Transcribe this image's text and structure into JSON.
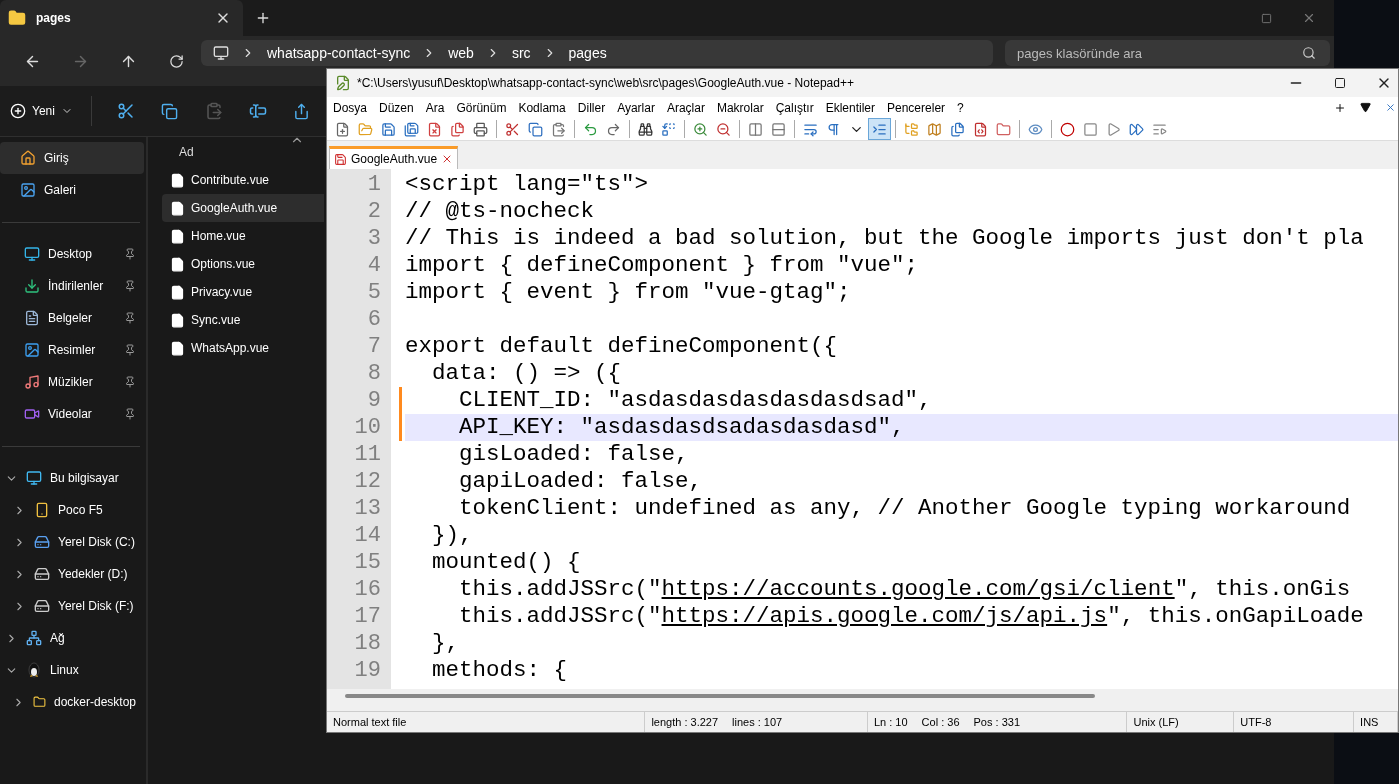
{
  "explorer": {
    "tab": {
      "title": "pages",
      "selected": true
    },
    "nav": {
      "forward_disabled": true,
      "crumbs": [
        "whatsapp-contact-sync",
        "web",
        "src",
        "pages"
      ]
    },
    "search": {
      "placeholder": "pages klasöründe ara"
    },
    "toolbar": {
      "new_label": "Yeni",
      "paste_disabled": true
    },
    "sidebar": {
      "quick": [
        {
          "label": "Giriş",
          "kind": "home",
          "selected": true
        },
        {
          "label": "Galeri",
          "kind": "gallery",
          "selected": false
        }
      ],
      "pinned": [
        {
          "label": "Desktop",
          "kind": "desktop",
          "selected": false,
          "pinned": true
        },
        {
          "label": "İndirilenler",
          "kind": "downloads",
          "selected": false,
          "pinned": true
        },
        {
          "label": "Belgeler",
          "kind": "documents",
          "selected": false,
          "pinned": true
        },
        {
          "label": "Resimler",
          "kind": "pictures",
          "selected": false,
          "pinned": true
        },
        {
          "label": "Müzikler",
          "kind": "music",
          "selected": false,
          "pinned": true
        },
        {
          "label": "Videolar",
          "kind": "videos",
          "selected": false,
          "pinned": true
        }
      ],
      "tree": [
        {
          "label": "Bu bilgisayar",
          "kind": "pc",
          "selected": false,
          "expanded": true,
          "children": [
            {
              "label": "Poco F5",
              "kind": "phone",
              "selected": false,
              "expanded": false
            },
            {
              "label": "Yerel Disk (C:)",
              "kind": "systemdisk",
              "selected": false,
              "expanded": false
            },
            {
              "label": "Yedekler (D:)",
              "kind": "disk",
              "selected": false,
              "expanded": false
            },
            {
              "label": "Yerel Disk (F:)",
              "kind": "disk",
              "selected": false,
              "expanded": false
            }
          ]
        },
        {
          "label": "Ağ",
          "kind": "network",
          "selected": false,
          "expanded": false
        },
        {
          "label": "Linux",
          "kind": "linux",
          "selected": false,
          "expanded": true,
          "children": [
            {
              "label": "docker-desktop",
              "kind": "folder",
              "selected": false,
              "expanded": false
            }
          ]
        }
      ]
    },
    "files": {
      "header": "Ad",
      "items": [
        {
          "name": "Contribute.vue",
          "selected": false
        },
        {
          "name": "GoogleAuth.vue",
          "selected": true
        },
        {
          "name": "Home.vue",
          "selected": false
        },
        {
          "name": "Options.vue",
          "selected": false
        },
        {
          "name": "Privacy.vue",
          "selected": false
        },
        {
          "name": "Sync.vue",
          "selected": false
        },
        {
          "name": "WhatsApp.vue",
          "selected": false
        }
      ]
    }
  },
  "notepad": {
    "title": "*C:\\Users\\yusuf\\Desktop\\whatsapp-contact-sync\\web\\src\\pages\\GoogleAuth.vue - Notepad++",
    "menu": [
      "Dosya",
      "Düzen",
      "Ara",
      "Görünüm",
      "Kodlama",
      "Diller",
      "Ayarlar",
      "Araçlar",
      "Makrolar",
      "Çalıştır",
      "Eklentiler",
      "Pencereler",
      "?"
    ],
    "tabs": [
      {
        "label": "GoogleAuth.vue",
        "selected": true,
        "modified": true
      }
    ],
    "lines": [
      {
        "number": "1",
        "code": "<script lang=\"ts\">",
        "current": false,
        "changed": false
      },
      {
        "number": "2",
        "code": "// @ts-nocheck",
        "current": false,
        "changed": false
      },
      {
        "number": "3",
        "code": "// This is indeed a bad solution, but the Google imports just don't pla",
        "current": false,
        "changed": false
      },
      {
        "number": "4",
        "code": "import { defineComponent } from \"vue\";",
        "current": false,
        "changed": false
      },
      {
        "number": "5",
        "code": "import { event } from \"vue-gtag\";",
        "current": false,
        "changed": false
      },
      {
        "number": "6",
        "current": false,
        "changed": false
      },
      {
        "number": "7",
        "code": "export default defineComponent({",
        "current": false,
        "changed": false
      },
      {
        "number": "8",
        "code": "  data: () => ({",
        "current": false,
        "changed": false
      },
      {
        "number": "9",
        "code": "    CLIENT_ID: \"asdasdasdasdasdasdsad\",",
        "current": false,
        "changed": true
      },
      {
        "number": "10",
        "code": "    API_KEY: \"asdasdasdsadasdasdasd\",",
        "current": true,
        "changed": true
      },
      {
        "number": "11",
        "code": "    gisLoaded: false,",
        "current": false,
        "changed": false
      },
      {
        "number": "12",
        "code": "    gapiLoaded: false,",
        "current": false,
        "changed": false
      },
      {
        "number": "13",
        "code": "    tokenClient: undefined as any, // Another Google typing workaround",
        "current": false,
        "changed": false
      },
      {
        "number": "14",
        "code": "  }),",
        "current": false,
        "changed": false
      },
      {
        "number": "15",
        "code": "  mounted() {",
        "current": false,
        "changed": false
      },
      {
        "number": "16",
        "segments": [
          {
            "kind": "code",
            "text": "    this.addJSSrc(\""
          },
          {
            "kind": "link",
            "text": "https://accounts.google.com/gsi/client"
          },
          {
            "kind": "code",
            "text": "\", this.onGis"
          }
        ],
        "current": false,
        "changed": false
      },
      {
        "number": "17",
        "segments": [
          {
            "kind": "code",
            "text": "    this.addJSSrc(\""
          },
          {
            "kind": "link",
            "text": "https://apis.google.com/js/api.js"
          },
          {
            "kind": "code",
            "text": "\", this.onGapiLoade"
          }
        ],
        "current": false,
        "changed": false
      },
      {
        "number": "18",
        "code": "  },",
        "current": false,
        "changed": false
      },
      {
        "number": "19",
        "code": "  methods: {",
        "current": false,
        "changed": false
      }
    ],
    "status": [
      {
        "items": [
          "Normal text file"
        ]
      },
      {
        "items": [
          "length : 3.227",
          "lines : 107"
        ]
      },
      {
        "items": [
          "Ln : 10",
          "Col : 36",
          "Pos : 331"
        ]
      },
      {
        "items": [
          "Unix (LF)"
        ]
      },
      {
        "items": [
          "UTF-8"
        ]
      },
      {
        "items": [
          "INS"
        ]
      }
    ]
  }
}
